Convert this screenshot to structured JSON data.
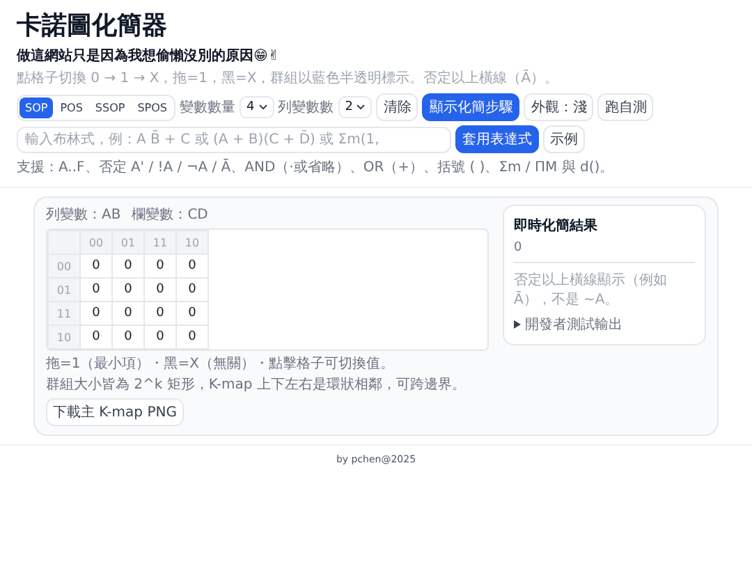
{
  "title": "卡諾圖化簡器",
  "subtitle": "做這網站只是因為我想偷懶沒別的原因😁✌",
  "hint": "點格子切換 0 → 1 → X，拖=1，黑=X，群組以藍色半透明標示。否定以上橫線（Ā）。",
  "forms": [
    {
      "label": "SOP",
      "selected": true
    },
    {
      "label": "POS",
      "selected": false
    },
    {
      "label": "SSOP",
      "selected": false
    },
    {
      "label": "SPOS",
      "selected": false
    }
  ],
  "var_count": {
    "label": "變數數量",
    "value": "4"
  },
  "row_vars": {
    "label": "列變數數",
    "value": "2"
  },
  "buttons": [
    {
      "label": "清除",
      "kind": "plain"
    },
    {
      "label": "顯示化簡步驟",
      "kind": "primary"
    },
    {
      "label": "外觀：淺",
      "kind": "plain"
    },
    {
      "label": "跑自測",
      "kind": "plain"
    }
  ],
  "expression": {
    "placeholder": "輸入布林式，例：A B̄ + C 或 (A + B)(C + D̄) 或 Σm(1,"
  },
  "expr_buttons": [
    {
      "label": "套用表達式",
      "kind": "primary"
    },
    {
      "label": "示例",
      "kind": "plain"
    }
  ],
  "support": "支援：A..F、否定 A' / !A / ¬A / Ā、AND（·或省略）、OR（+）、括號 ( )、Σm / ΠM 與 d()。",
  "kmap": {
    "row_label": "列變數：AB",
    "col_label": "欄變數：CD",
    "columns": [
      "00",
      "01",
      "11",
      "10"
    ],
    "rows": [
      {
        "header": "00",
        "cells": [
          "0",
          "0",
          "0",
          "0"
        ]
      },
      {
        "header": "01",
        "cells": [
          "0",
          "0",
          "0",
          "0"
        ]
      },
      {
        "header": "11",
        "cells": [
          "0",
          "0",
          "0",
          "0"
        ]
      },
      {
        "header": "10",
        "cells": [
          "0",
          "0",
          "0",
          "0"
        ]
      }
    ],
    "notes": [
      "拖=1（最小項）・黑=X（無關）・點擊格子可切換值。",
      "群組大小皆為 2^k 矩形，K-map 上下左右是環狀相鄰，可跨邊界。"
    ],
    "download": "下載主 K-map PNG"
  },
  "result": {
    "title": "即時化簡結果",
    "value": "0",
    "note": "否定以上橫線顯示（例如 Ā），不是 ~A。",
    "details": "開發者測試輸出",
    "expanded": false
  },
  "footer": "by pchen@2025"
}
